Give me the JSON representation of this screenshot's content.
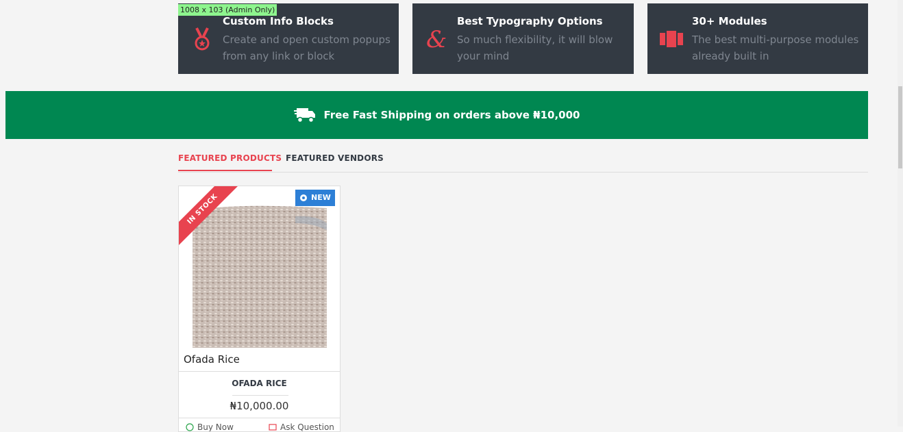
{
  "admin_tag": "1008 x 103 (Admin Only)",
  "info_blocks": [
    {
      "title": "Custom Info Blocks",
      "text": "Create and open custom popups from any link or block",
      "icon": "medal-icon"
    },
    {
      "title": "Best Typography Options",
      "text": "So much flexibility, it will blow your mind",
      "icon": "ampersand-icon"
    },
    {
      "title": "30+ Modules",
      "text": "The best multi-purpose modules already built in",
      "icon": "modules-icon"
    }
  ],
  "shipping": {
    "text": "Free Fast Shipping on orders above ₦10,000",
    "icon": "truck-icon"
  },
  "tabs": [
    {
      "label": "FEATURED PRODUCTS",
      "active": true
    },
    {
      "label": "FEATURED VENDORS",
      "active": false
    }
  ],
  "product": {
    "ribbon": "IN STOCK",
    "badge": "NEW",
    "name": "Ofada Rice",
    "vendor": "OFADA RICE",
    "price": "₦10,000.00",
    "buy_now": "Buy Now",
    "ask_question": "Ask Question"
  },
  "colors": {
    "accent": "#e8434f",
    "green": "#008751",
    "dark": "#333a43",
    "blue": "#2d7fd6"
  }
}
